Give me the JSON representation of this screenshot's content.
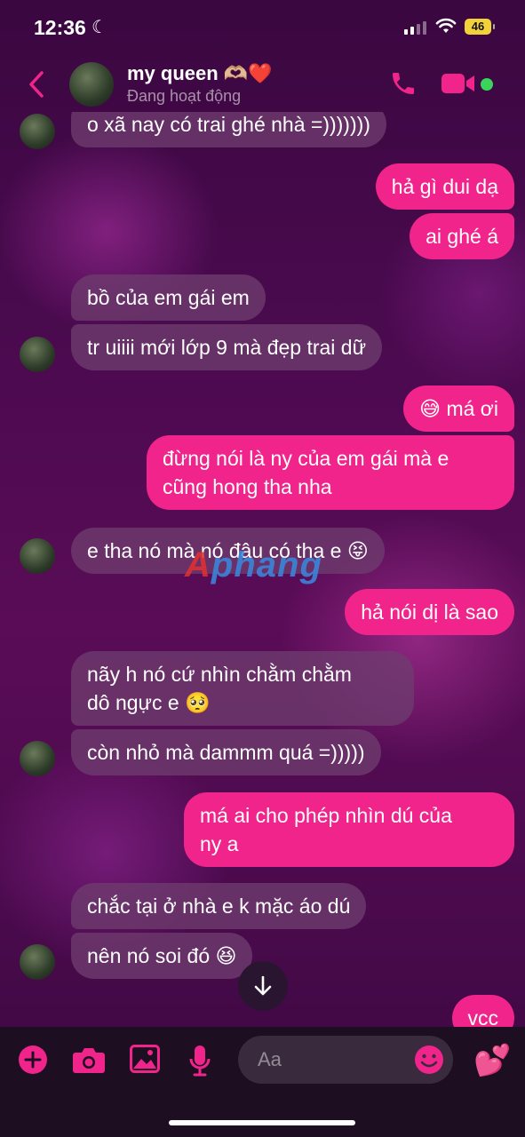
{
  "status_bar": {
    "time": "12:36",
    "battery": "46"
  },
  "header": {
    "contact_name": "my queen 🫶🏼❤️",
    "presence": "Đang hoạt động"
  },
  "messages": [
    {
      "dir": "in",
      "text": "o xã nay có trai ghé nhà =)))))))"
    },
    {
      "dir": "out",
      "text": "hả gì dui dạ"
    },
    {
      "dir": "out",
      "text": "ai ghé á"
    },
    {
      "dir": "in",
      "text": "bồ của em gái em"
    },
    {
      "dir": "in",
      "text": "tr uiiii mới lớp 9 mà đẹp trai dữ"
    },
    {
      "dir": "out",
      "text": "😅 má ơi"
    },
    {
      "dir": "out",
      "line1": "đừng nói là ny của em gái mà e",
      "line2": "cũng hong tha nha"
    },
    {
      "dir": "in",
      "text": "e tha nó mà nó đâu có tha e 😝"
    },
    {
      "dir": "out",
      "text": "hả nói dị là sao"
    },
    {
      "dir": "in",
      "line1": "nãy h nó cứ nhìn chằm chằm",
      "line2": "dô ngực e 🥺"
    },
    {
      "dir": "in",
      "text": "còn nhỏ mà dammm quá =)))))"
    },
    {
      "dir": "out",
      "line1": "má ai cho phép nhìn dú của",
      "line2": "ny a"
    },
    {
      "dir": "in",
      "text": "chắc tại ở nhà e k mặc áo dú"
    },
    {
      "dir": "in",
      "text": "nên nó soi đó 😆"
    },
    {
      "dir": "out",
      "text": "vcc"
    }
  ],
  "watermark": {
    "part1": "A",
    "part2": "phang"
  },
  "composer": {
    "placeholder": "Aa",
    "like_emoji": "💕"
  },
  "colors": {
    "accent": "#f0248a",
    "incoming_bubble": "#6e3c6e",
    "online": "#3bd45a"
  }
}
